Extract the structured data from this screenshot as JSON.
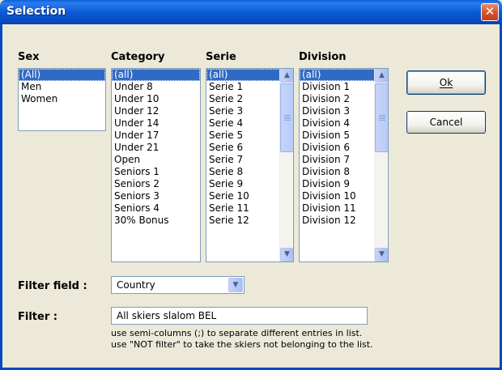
{
  "window": {
    "title": "Selection",
    "close_glyph": "✕"
  },
  "sex": {
    "header": "Sex",
    "items": [
      "(All)",
      "Men",
      "Women"
    ],
    "selected_index": 0
  },
  "category": {
    "header": "Category",
    "items": [
      "(all)",
      "Under 8",
      "Under 10",
      "Under 12",
      "Under 14",
      "Under 17",
      "Under 21",
      "Open",
      "Seniors 1",
      "Seniors 2",
      "Seniors 3",
      "Seniors 4",
      "30% Bonus"
    ],
    "selected_index": 0
  },
  "serie": {
    "header": "Serie",
    "items": [
      "(all)",
      "Serie 1",
      "Serie 2",
      "Serie 3",
      "Serie 4",
      "Serie 5",
      "Serie 6",
      "Serie 7",
      "Serie 8",
      "Serie 9",
      "Serie 10",
      "Serie 11",
      "Serie 12"
    ],
    "selected_index": 0
  },
  "division": {
    "header": "Division",
    "items": [
      "(all)",
      "Division 1",
      "Division 2",
      "Division 3",
      "Division 4",
      "Division 5",
      "Division 6",
      "Division 7",
      "Division 8",
      "Division 9",
      "Division 10",
      "Division 11",
      "Division 12"
    ],
    "selected_index": 0
  },
  "buttons": {
    "ok_label": "Ok",
    "cancel_label": "Cancel"
  },
  "filter_field": {
    "label": "Filter field :",
    "value": "Country"
  },
  "filter": {
    "label": "Filter :",
    "value": "All skiers slalom BEL",
    "hint_line1": "use semi-columns (;) to separate different entries in list.",
    "hint_line2": "use \"NOT filter\" to take the skiers not belonging to the list."
  },
  "icons": {
    "scroll_up": "▲",
    "scroll_down": "▼",
    "dropdown": "▼"
  }
}
